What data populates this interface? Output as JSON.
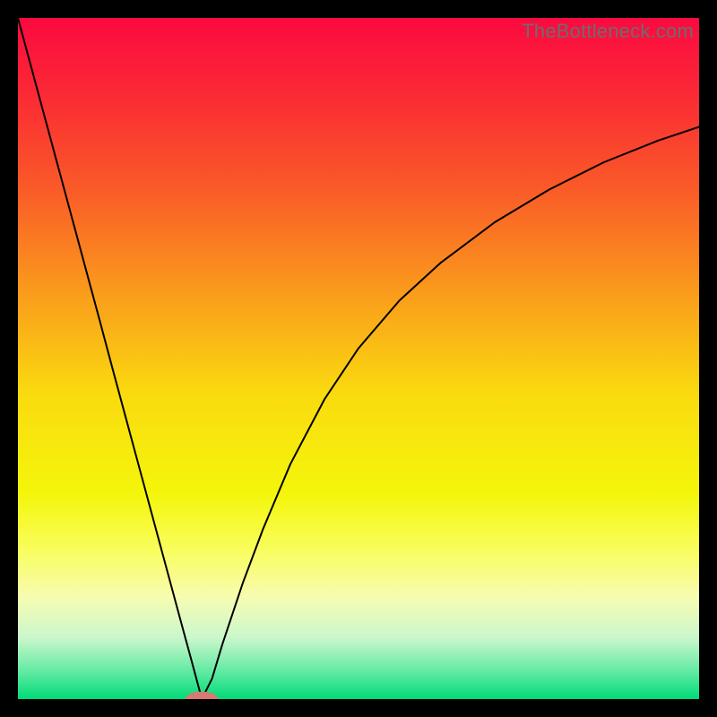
{
  "watermark": "TheBottleneck.com",
  "chart_data": {
    "type": "line",
    "title": "",
    "xlabel": "",
    "ylabel": "",
    "xlim": [
      0,
      100
    ],
    "ylim": [
      0,
      100
    ],
    "background_gradient": {
      "stops": [
        {
          "pos": 0.0,
          "color": "#fb0940"
        },
        {
          "pos": 0.12,
          "color": "#fb2c34"
        },
        {
          "pos": 0.25,
          "color": "#fa5a28"
        },
        {
          "pos": 0.4,
          "color": "#fa9a1c"
        },
        {
          "pos": 0.55,
          "color": "#fada0f"
        },
        {
          "pos": 0.7,
          "color": "#f4f60b"
        },
        {
          "pos": 0.78,
          "color": "#f9fd5c"
        },
        {
          "pos": 0.85,
          "color": "#f7fcb1"
        },
        {
          "pos": 0.91,
          "color": "#caf7cc"
        },
        {
          "pos": 0.96,
          "color": "#61eaa2"
        },
        {
          "pos": 1.0,
          "color": "#00db78"
        }
      ]
    },
    "marker": {
      "x": 27,
      "y": 0,
      "color": "#d77a72",
      "rx": 2.4,
      "ry": 1.1
    },
    "series": [
      {
        "name": "curve",
        "color": "#000000",
        "stroke_width": 2,
        "x": [
          0,
          2,
          4,
          6,
          8,
          10,
          12,
          14,
          16,
          18,
          20,
          22,
          24,
          25.5,
          27,
          28.5,
          30,
          33,
          36,
          40,
          45,
          50,
          56,
          62,
          70,
          78,
          86,
          94,
          100
        ],
        "y": [
          100,
          92.6,
          85.2,
          77.8,
          70.4,
          63.0,
          55.6,
          48.1,
          40.7,
          33.3,
          25.9,
          18.5,
          11.1,
          5.6,
          0.0,
          3.0,
          8.0,
          17.0,
          25.0,
          34.5,
          44.0,
          51.5,
          58.5,
          64.0,
          70.0,
          74.8,
          78.8,
          82.0,
          84.0
        ]
      }
    ]
  }
}
